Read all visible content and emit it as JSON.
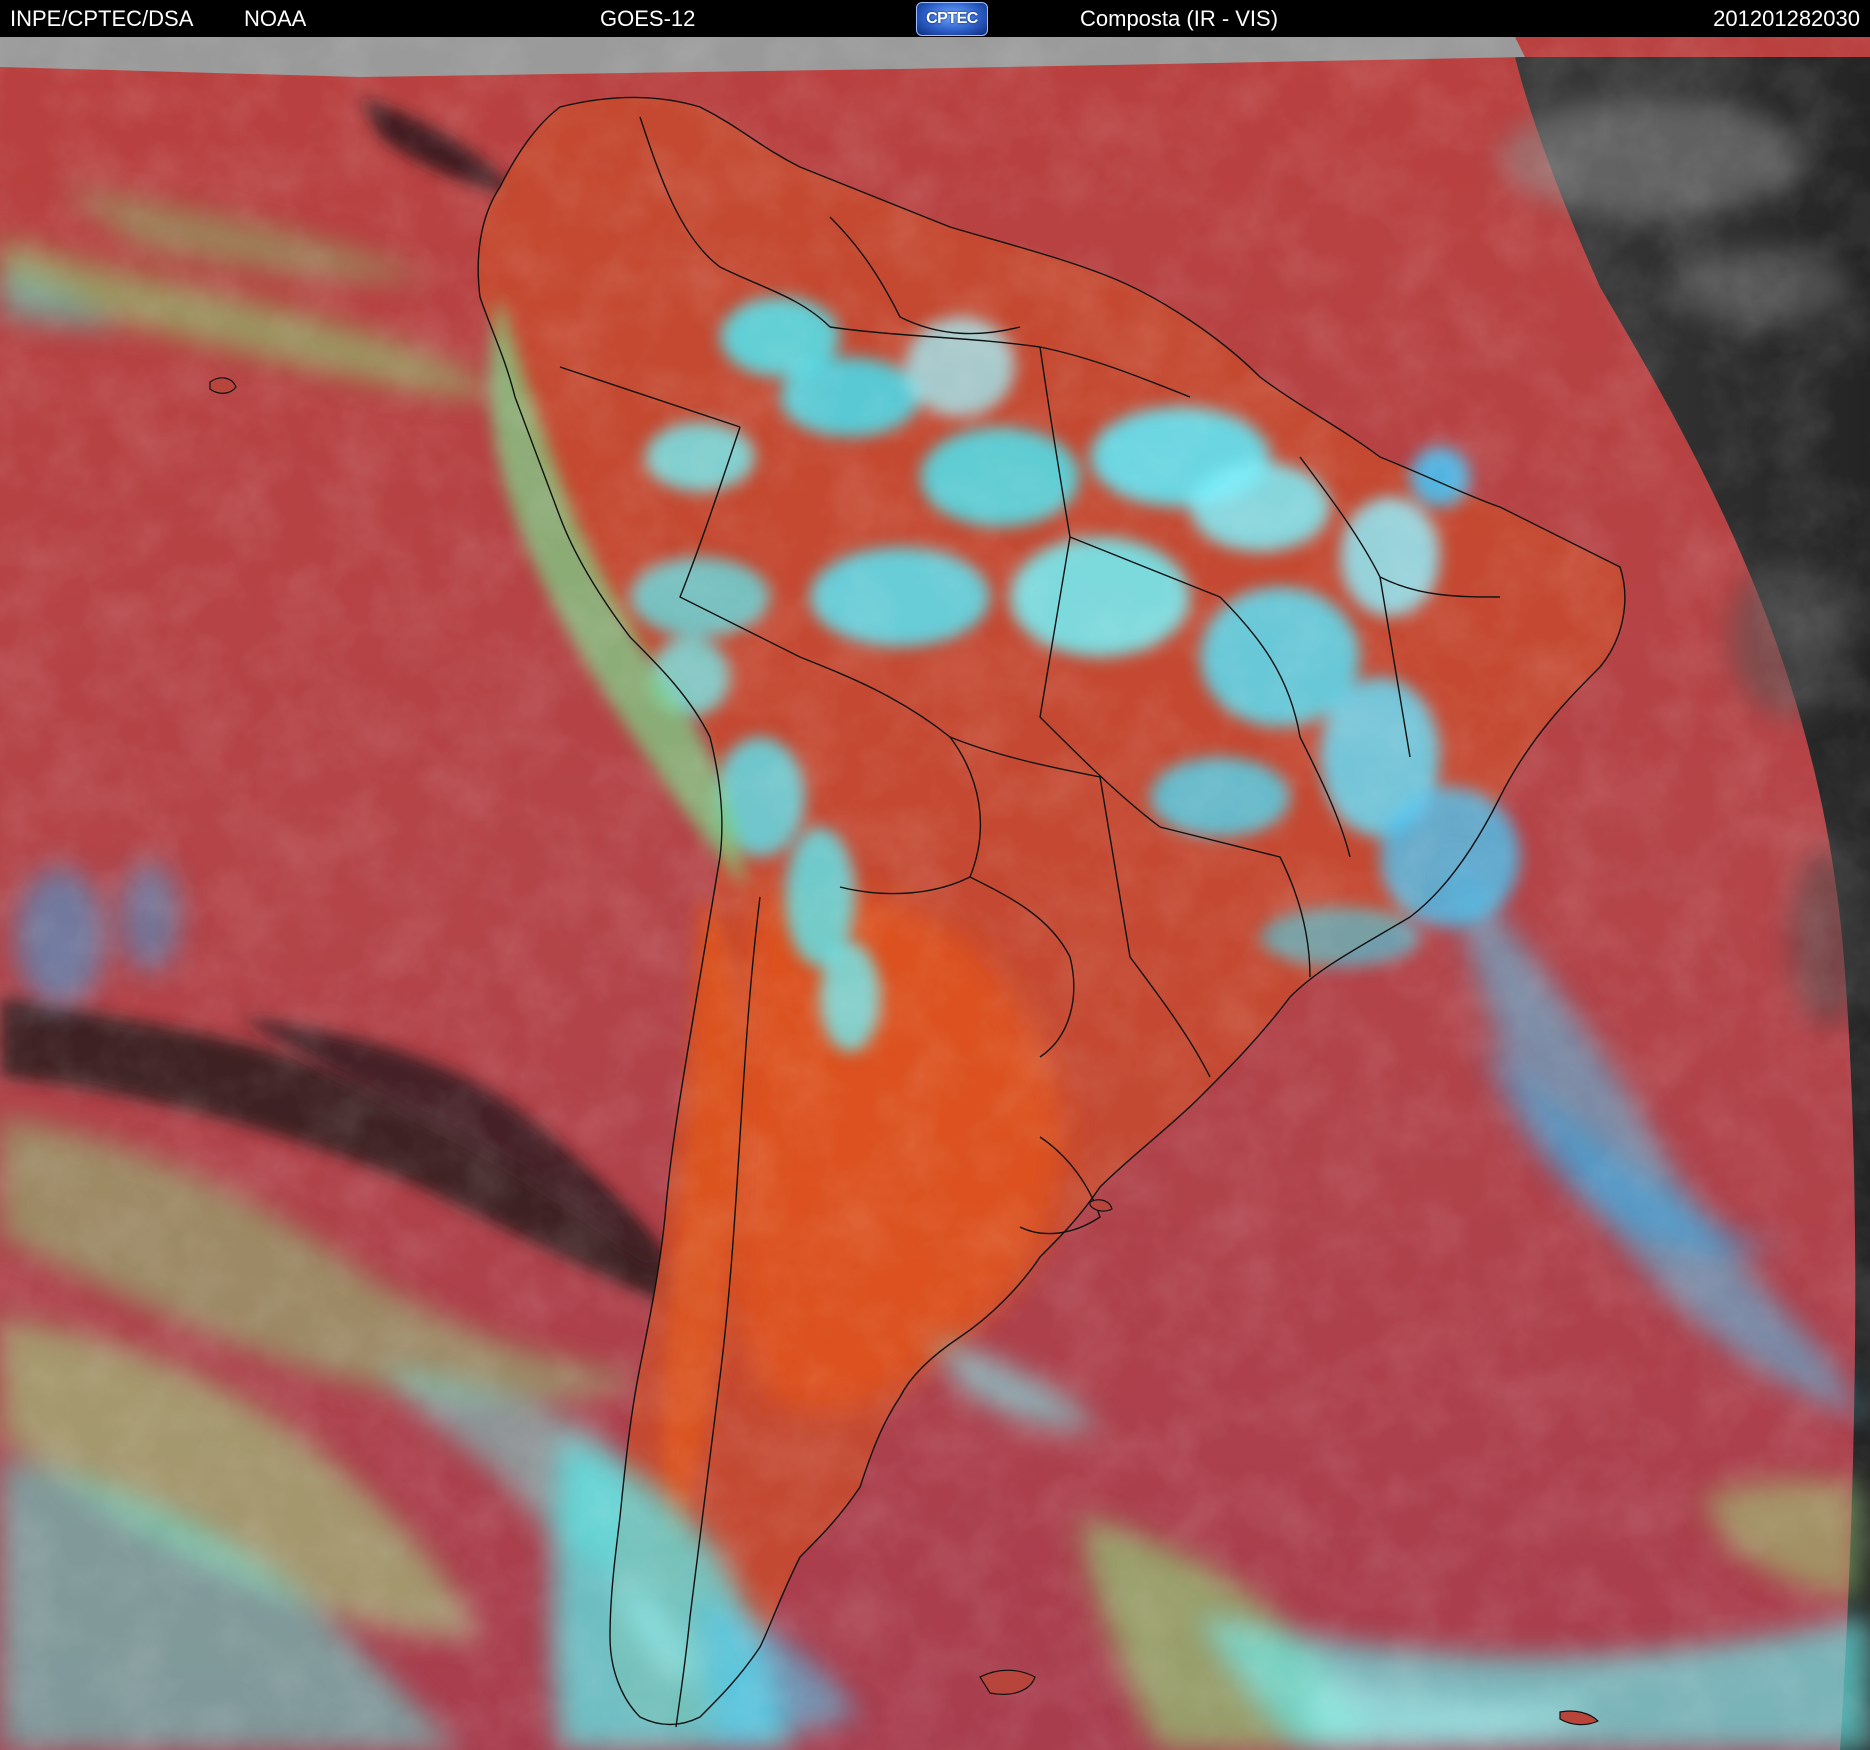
{
  "header": {
    "agency": "INPE/CPTEC/DSA",
    "partner": "NOAA",
    "satellite": "GOES-12",
    "logo_text": "CPTEC",
    "product": "Composta (IR - VIS)",
    "timestamp": "201201282030"
  },
  "colors": {
    "clear_ocean": "#b84045",
    "clear_land": "#cc4a2a",
    "low_cloud": "#8ee07a",
    "high_cloud": "#3fe6f0",
    "no_data": "#9a9a9a",
    "night_side": "#2b2b2b"
  }
}
